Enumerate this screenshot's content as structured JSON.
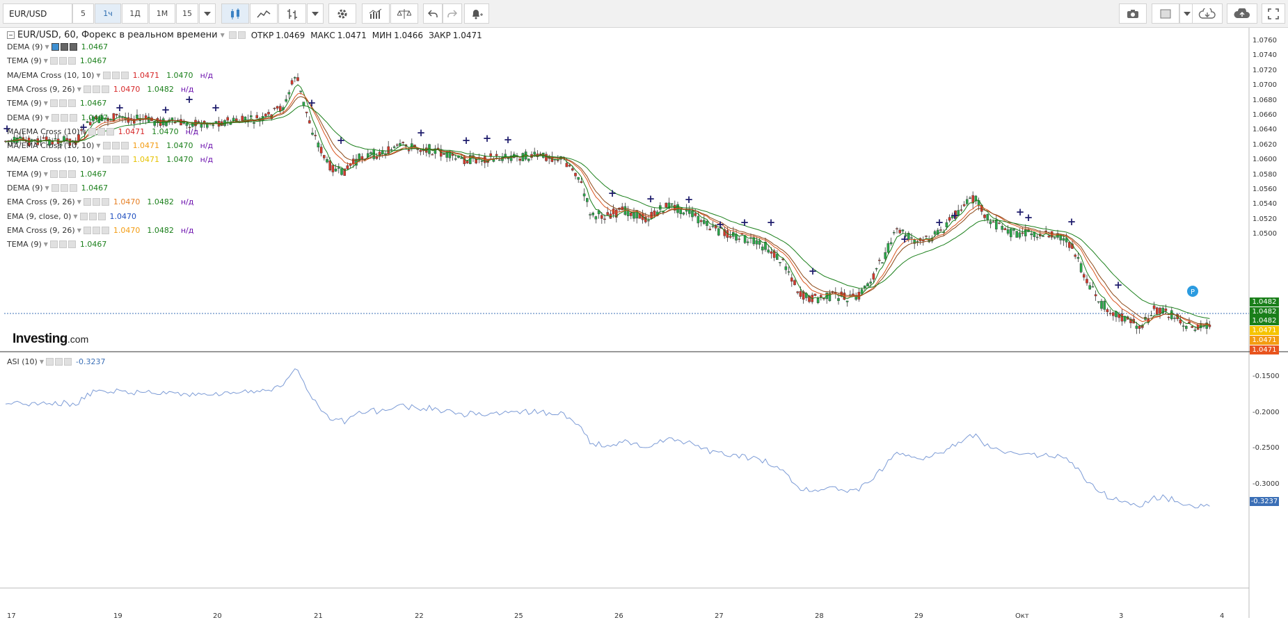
{
  "toolbar": {
    "symbol": "EUR/USD",
    "intervals": [
      "5",
      "1ч",
      "1Д",
      "1М",
      "15"
    ],
    "active_interval": "1ч"
  },
  "header": {
    "title": "EUR/USD, 60, Форекс в реальном времени",
    "open_label": "ОТКР",
    "open_value": "1.0469",
    "high_label": "МАКС",
    "high_value": "1.0471",
    "low_label": "МИН",
    "low_value": "1.0466",
    "close_label": "ЗАКР",
    "close_value": "1.0471"
  },
  "indicators": [
    {
      "name": "DEMA (9)",
      "values": [
        "1.0467"
      ],
      "colors": [
        "#1a7f1a"
      ]
    },
    {
      "name": "TEMA (9)",
      "values": [
        "1.0467"
      ],
      "colors": [
        "#1a7f1a"
      ]
    },
    {
      "name": "MA/EMA Cross (10, 10)",
      "values": [
        "1.0471",
        "1.0470",
        "н/д"
      ],
      "colors": [
        "#d62728",
        "#1a7f1a",
        "#6a0dad"
      ]
    },
    {
      "name": "EMA Cross (9, 26)",
      "values": [
        "1.0470",
        "1.0482",
        "н/д"
      ],
      "colors": [
        "#d62728",
        "#1a7f1a",
        "#6a0dad"
      ]
    },
    {
      "name": "TEMA (9)",
      "values": [
        "1.0467"
      ],
      "colors": [
        "#1a7f1a"
      ]
    },
    {
      "name": "DEMA (9)",
      "values": [
        "1.0467"
      ],
      "colors": [
        "#1a7f1a"
      ]
    },
    {
      "name": "MA/EMA Cross (10)",
      "values": [
        "1.0471",
        "1.0470",
        "н/д"
      ],
      "colors": [
        "#d62728",
        "#1a7f1a",
        "#6a0dad"
      ]
    },
    {
      "name": "MA/EMA Cross (10, 10)",
      "values": [
        "1.0471",
        "1.0470",
        "н/д"
      ],
      "colors": [
        "#f39c12",
        "#1a7f1a",
        "#6a0dad"
      ]
    },
    {
      "name": "MA/EMA Cross (10, 10)",
      "values": [
        "1.0471",
        "1.0470",
        "н/д"
      ],
      "colors": [
        "#e6c200",
        "#1a7f1a",
        "#6a0dad"
      ]
    },
    {
      "name": "TEMA (9)",
      "values": [
        "1.0467"
      ],
      "colors": [
        "#1a7f1a"
      ]
    },
    {
      "name": "DEMA (9)",
      "values": [
        "1.0467"
      ],
      "colors": [
        "#1a7f1a"
      ]
    },
    {
      "name": "EMA Cross (9, 26)",
      "values": [
        "1.0470",
        "1.0482",
        "н/д"
      ],
      "colors": [
        "#e67e22",
        "#1a7f1a",
        "#6a0dad"
      ]
    },
    {
      "name": "EMA (9, close, 0)",
      "values": [
        "1.0470"
      ],
      "colors": [
        "#1f4fbf"
      ]
    },
    {
      "name": "EMA Cross (9, 26)",
      "values": [
        "1.0470",
        "1.0482",
        "н/д"
      ],
      "colors": [
        "#f39c12",
        "#1a7f1a",
        "#6a0dad"
      ]
    },
    {
      "name": "TEMA (9)",
      "values": [
        "1.0467"
      ],
      "colors": [
        "#1a7f1a"
      ]
    }
  ],
  "price_axis": [
    "1.0760",
    "1.0740",
    "1.0720",
    "1.0700",
    "1.0680",
    "1.0660",
    "1.0640",
    "1.0620",
    "1.0600",
    "1.0580",
    "1.0560",
    "1.0540",
    "1.0520",
    "1.0500"
  ],
  "price_tags": [
    {
      "value": "1.0482",
      "color": "#1a7f1a"
    },
    {
      "value": "1.0482",
      "color": "#1a7f1a"
    },
    {
      "value": "1.0482",
      "color": "#1a7f1a"
    },
    {
      "value": "1.0471",
      "color": "#f5c400"
    },
    {
      "value": "1.0471",
      "color": "#f39c12"
    },
    {
      "value": "1.0471",
      "color": "#e8541e"
    }
  ],
  "brand": {
    "name": "Investing",
    "suffix": ".com"
  },
  "asi": {
    "label": "ASI (10)",
    "value": "-0.3237",
    "axis": [
      "-0.1500",
      "-0.2000",
      "-0.2500",
      "-0.3000"
    ],
    "current_tag": "-0.3237"
  },
  "x_axis": [
    "17",
    "19",
    "20",
    "21",
    "22",
    "25",
    "26",
    "27",
    "28",
    "29",
    "Окт",
    "3",
    "4"
  ],
  "marker_label": "P"
}
